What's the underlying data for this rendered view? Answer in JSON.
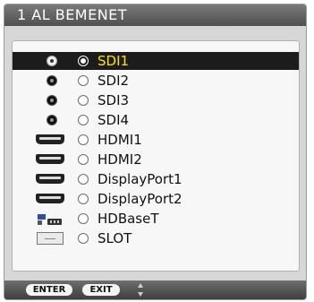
{
  "menu_title": "1 AL BEMENET",
  "inputs": [
    {
      "label": "SDI1",
      "icon": "sdi-connector-icon",
      "selected": true
    },
    {
      "label": "SDI2",
      "icon": "sdi-connector-icon",
      "selected": false
    },
    {
      "label": "SDI3",
      "icon": "sdi-connector-icon",
      "selected": false
    },
    {
      "label": "SDI4",
      "icon": "sdi-connector-icon",
      "selected": false
    },
    {
      "label": "HDMI1",
      "icon": "hdmi-connector-icon",
      "selected": false
    },
    {
      "label": "HDMI2",
      "icon": "hdmi-connector-icon",
      "selected": false
    },
    {
      "label": "DisplayPort1",
      "icon": "displayport-connector-icon",
      "selected": false
    },
    {
      "label": "DisplayPort2",
      "icon": "displayport-connector-icon",
      "selected": false
    },
    {
      "label": "HDBaseT",
      "icon": "hdbaset-network-icon",
      "selected": false
    },
    {
      "label": "SLOT",
      "icon": "slot-card-icon",
      "selected": false
    }
  ],
  "footer": {
    "enter_label": "ENTER",
    "exit_label": "EXIT",
    "nav_icon": "up-down-arrows-icon"
  },
  "colors": {
    "selected_text": "#ffe400",
    "selected_row": "#1c1c1c",
    "header_bg": "#5f5f5f"
  }
}
